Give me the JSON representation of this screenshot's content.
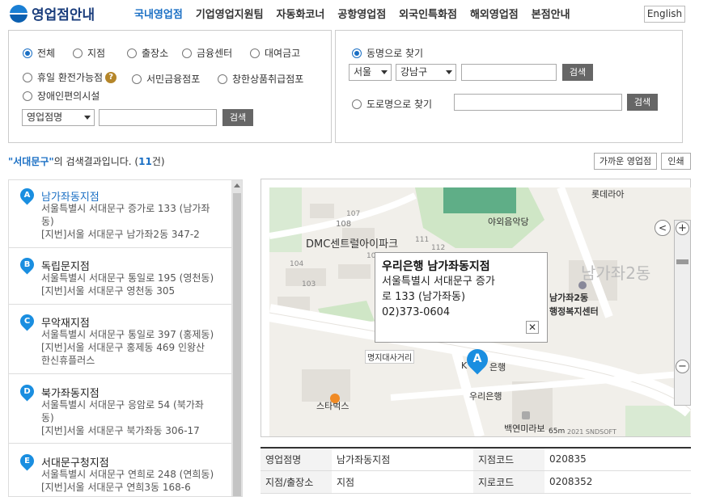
{
  "header": {
    "logo_text": "영업점안내",
    "nav": [
      "국내영업점",
      "기업영업지원팀",
      "자동화코너",
      "공항영업점",
      "외국인특화점",
      "해외영업점",
      "본점안내"
    ],
    "english_label": "English"
  },
  "search_left": {
    "radios": [
      "전체",
      "지점",
      "출장소",
      "금융센터",
      "대여금고",
      "휴일 환전가능점",
      "서민금융점포",
      "창한상품취급점포",
      "장애인편의시설"
    ],
    "help_icon": "?",
    "type_select": "영업점명",
    "search_label": "검색"
  },
  "search_right": {
    "dong_radio": "동명으로 찾기",
    "city_select": "서울",
    "district_select": "강남구",
    "search_label": "검색",
    "road_radio": "도로명으로 찾기",
    "road_search_label": "검색"
  },
  "results": {
    "keyword": "\"서대문구\"",
    "text_mid": "의 검색결과입니다. (",
    "count": "11",
    "text_end": "건)",
    "nearby_label": "가까운 영업점",
    "print_label": "인쇄"
  },
  "branches": [
    {
      "letter": "A",
      "name": "남가좌동지점",
      "lines": [
        "서울특별시 서대문구 증가로 133 (남가좌",
        "동)",
        "[지번]서울 서대문구 남가좌2동 347-2"
      ]
    },
    {
      "letter": "B",
      "name": "독립문지점",
      "lines": [
        "서울특별시 서대문구 통일로 195 (영천동)",
        "[지번]서울 서대문구 영천동 305"
      ]
    },
    {
      "letter": "C",
      "name": "무악재지점",
      "lines": [
        "서울특별시 서대문구 통일로 397 (홍제동)",
        "[지번]서울 서대문구 홍제동 469 인왕산",
        "한신휴플러스"
      ]
    },
    {
      "letter": "D",
      "name": "북가좌동지점",
      "lines": [
        "서울특별시 서대문구 응암로 54 (북가좌",
        "동)",
        "[지번]서울 서대문구 북가좌동 306-17"
      ]
    },
    {
      "letter": "E",
      "name": "서대문구청지점",
      "lines": [
        "서울특별시 서대문구 연희로 248 (연희동)",
        "[지번]서울 서대문구 연희3동 168-6"
      ]
    }
  ],
  "map": {
    "labels": [
      "롯데라아",
      "야외음악당",
      "DMC센트럴아이파크",
      "108",
      "남가좌2동",
      "남가좌2동",
      "행정복지센터",
      "명지대사거리",
      "K",
      "은행",
      "우리은행",
      "스타벅스",
      "백연미라보",
      "65m",
      "2021 SNDSOFT",
      "107",
      "108",
      "104",
      "103",
      "111",
      "112"
    ],
    "marker_letter": "A",
    "popup": {
      "title": "우리은행 남가좌동지점",
      "lines": [
        "서울특별시 서대문구 증가",
        "로 133 (남가좌동)",
        "02)373-0604"
      ]
    },
    "zoom_in": "+",
    "zoom_out": "−",
    "pan": "<"
  },
  "info": {
    "rows": [
      [
        "영업점명",
        "남가좌동지점",
        "지점코드",
        "020835"
      ],
      [
        "지점/출장소",
        "지점",
        "지로코드",
        "0208352"
      ]
    ]
  }
}
